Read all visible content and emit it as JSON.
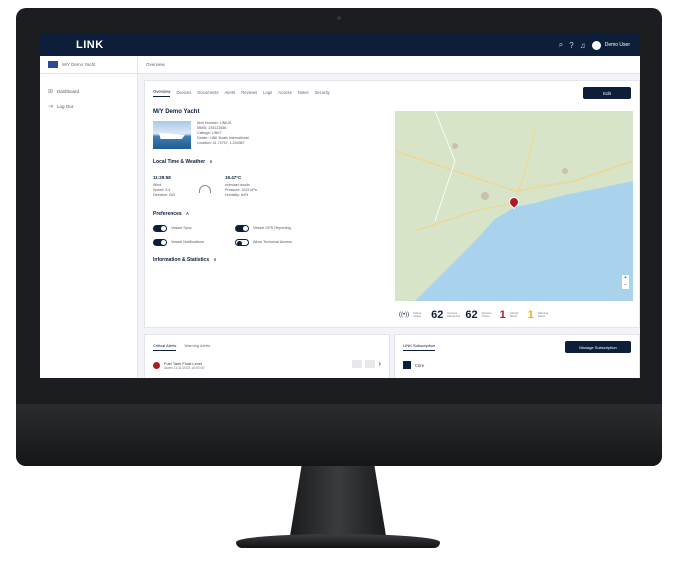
{
  "app": {
    "logo": "LINK",
    "user_name": "Demo User"
  },
  "vessel_chip": {
    "label": "M/Y Demo Yacht"
  },
  "breadcrumb": "Overview",
  "sidebar": {
    "items": [
      {
        "label": "Dashboard",
        "icon": "grid-icon"
      },
      {
        "label": "Log Out",
        "icon": "logout-icon"
      }
    ]
  },
  "tabs": [
    "Overview",
    "Devices",
    "Documents",
    "Alerts",
    "Reviews",
    "Logs",
    "Access",
    "Notes",
    "Security"
  ],
  "edit_label": "Edit",
  "vessel": {
    "name": "M/Y Demo Yacht",
    "details": [
      "Item Number: LINK01",
      "MMSI: 235123456",
      "Callsign: LINK7",
      "Dealer: LINK Boats International",
      "Location: 41.74757, 1.244987"
    ]
  },
  "local_time": {
    "title": "Local Time & Weather",
    "time": "11:29:58",
    "wind_lines": [
      "Wind",
      "Speed: 5.4",
      "Direction: 263"
    ],
    "temp": "19.47°C",
    "weather_lines": [
      "overcast clouds",
      "Pressure: 1023 hPa",
      "Humidity: 64%"
    ]
  },
  "preferences": {
    "title": "Preferences",
    "items": [
      {
        "label": "Vessel Sync",
        "on": true
      },
      {
        "label": "Vessel GPS Reporting",
        "on": true
      },
      {
        "label": "Vessel Notifications",
        "on": true
      },
      {
        "label": "Allow Technical Access",
        "on": false
      }
    ]
  },
  "info_stats_title": "Information & Statistics",
  "stats": [
    {
      "label": "Status: Online",
      "value": "",
      "icon": "signal-icon"
    },
    {
      "label": "Devices Monitored",
      "value": "62",
      "color": "navy"
    },
    {
      "label": "Devices Online",
      "value": "62",
      "color": "navy"
    },
    {
      "label": "Critical Alerts",
      "value": "1",
      "color": "#b0182a"
    },
    {
      "label": "Warning Alerts",
      "value": "1",
      "color": "#e6b800"
    }
  ],
  "alerts": {
    "tabs": [
      "Critical Alerts",
      "Warning Alerts"
    ],
    "row_title": "Fuel Tank Float Level",
    "row_sub": "Alarm 11/11/2023 15:00:00"
  },
  "subscription": {
    "tab": "LINK Subscription",
    "manage_label": "Manage Subscription",
    "plan": "Core"
  },
  "colors": {
    "navy": "#0c1e3a",
    "critical": "#b0182a",
    "warning": "#e6b800",
    "sea": "#a9d3ec",
    "land": "#d8e4c8"
  }
}
